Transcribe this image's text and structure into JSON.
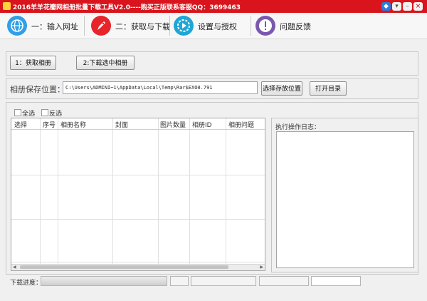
{
  "window": {
    "title": "2016羊羊花瓣网相册批量下载工具V2.0----购买正版联系客服QQ：3699463",
    "title_color": "#d9141c"
  },
  "tabs": [
    {
      "label": "一：输入网址",
      "icon": "globe-icon",
      "color": "#2f9fe8"
    },
    {
      "label": "二：获取与下载",
      "icon": "rocket-icon",
      "color": "#e8242b"
    },
    {
      "label": "设置与授权",
      "icon": "play-gear-icon",
      "color": "#1fa6d6"
    },
    {
      "label": "问题反馈",
      "icon": "exclamation-icon",
      "color": "#7b58b0"
    }
  ],
  "actions": {
    "fetch_album": "1：获取相册",
    "download_selected": "2:下载选中相册"
  },
  "save": {
    "label": "相册保存位置：",
    "path": "C:\\Users\\ADMINI~1\\AppData\\Local\\Temp\\Rar$EXO0.791",
    "choose_button": "选择存放位置",
    "open_button": "打开目录"
  },
  "selection": {
    "select_all": "全选",
    "invert": "反选"
  },
  "table": {
    "columns": [
      "选择",
      "序号",
      "相册名称",
      "封面",
      "图片数量",
      "相册ID",
      "相册问题"
    ]
  },
  "log": {
    "label": "执行操作日志："
  },
  "progress": {
    "label": "下载进度：",
    "value": 0
  }
}
